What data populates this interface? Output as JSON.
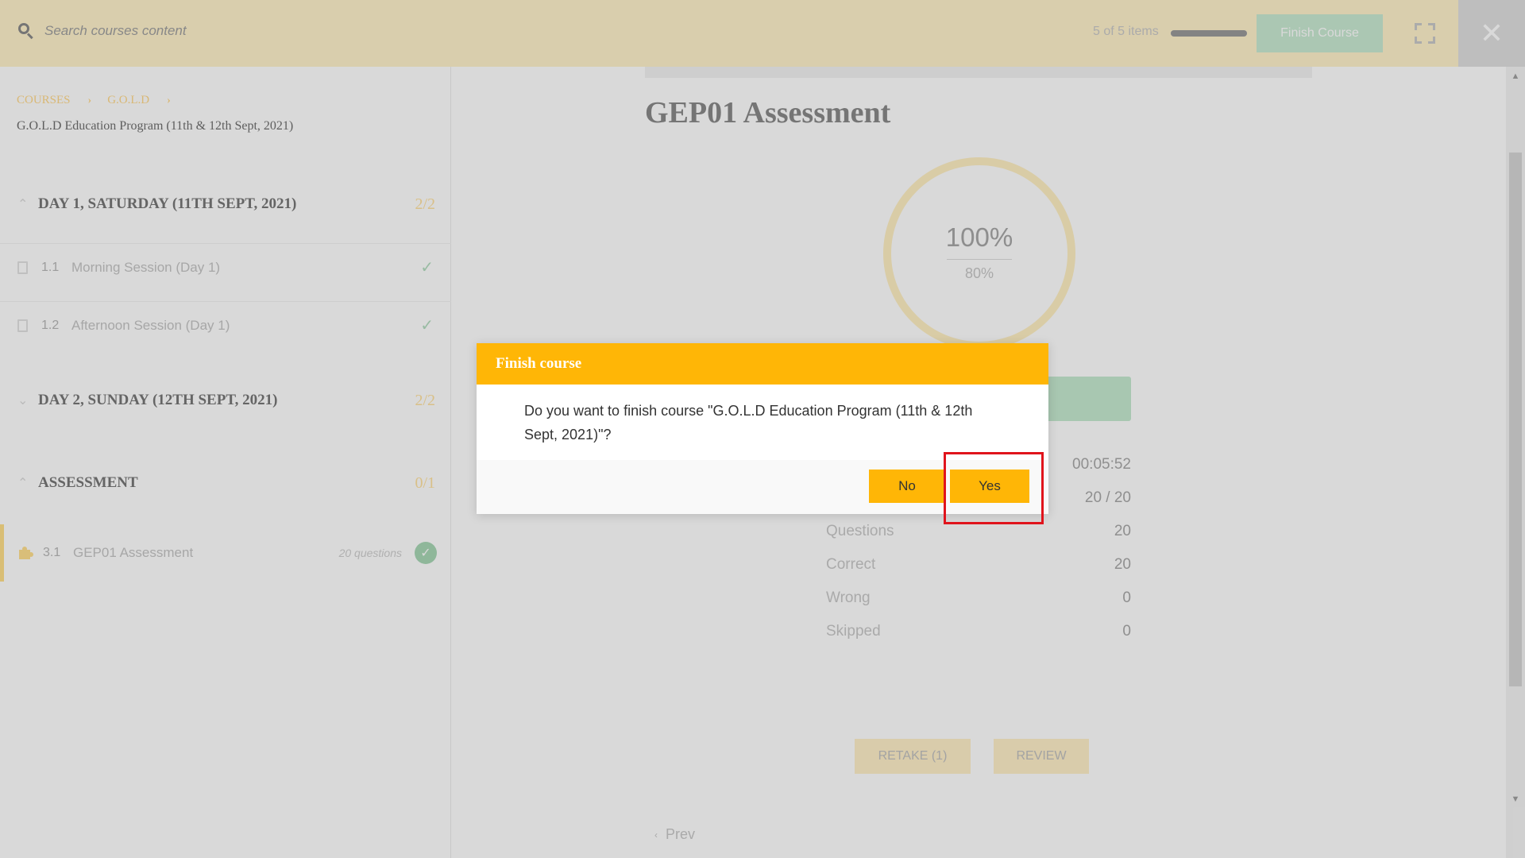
{
  "header": {
    "search_placeholder": "Search courses content",
    "items_count": "5 of 5 items",
    "progress_fraction": 1.0,
    "finish_label": "Finish Course",
    "close_symbol": "✕"
  },
  "sidebar": {
    "breadcrumb": [
      "COURSES",
      "G.O.L.D"
    ],
    "breadcrumb_sep": "›",
    "course_title": "G.O.L.D Education Program (11th & 12th Sept, 2021)",
    "sections": [
      {
        "title": "DAY 1, SATURDAY (11TH SEPT, 2021)",
        "count": "2/2",
        "chevron": "⌃",
        "lessons": [
          {
            "num": "1.1",
            "title": "Morning Session (Day 1)",
            "done": "✓"
          },
          {
            "num": "1.2",
            "title": "Afternoon Session (Day 1)",
            "done": "✓"
          }
        ]
      },
      {
        "title": "DAY 2, SUNDAY (12TH SEPT, 2021)",
        "count": "2/2",
        "chevron": "⌄"
      },
      {
        "title": "ASSESSMENT",
        "count": "0/1",
        "chevron": "⌃",
        "lessons": [
          {
            "num": "3.1",
            "title": "GEP01 Assessment",
            "questions": "20 questions",
            "done": "✓"
          }
        ]
      }
    ]
  },
  "main": {
    "quiz_title": "GEP01 Assessment",
    "score": "100%",
    "passing": "80%",
    "stats": [
      {
        "label": "",
        "value": "00:05:52"
      },
      {
        "label": "",
        "value": "20 / 20"
      },
      {
        "label": "Questions",
        "value": "20"
      },
      {
        "label": "Correct",
        "value": "20"
      },
      {
        "label": "Wrong",
        "value": "0"
      },
      {
        "label": "Skipped",
        "value": "0"
      }
    ],
    "retake_label": "RETAKE (1)",
    "review_label": "REVIEW",
    "prev_label": "Prev",
    "prev_chevron": "‹"
  },
  "dialog": {
    "title": "Finish course",
    "message": "Do you want to finish course \"G.O.L.D Education Program (11th & 12th Sept, 2021)\"?",
    "no_label": "No",
    "yes_label": "Yes"
  },
  "colors": {
    "accent": "#ffb606",
    "highlight": "#e0141c",
    "success": "#a8d8b6"
  }
}
